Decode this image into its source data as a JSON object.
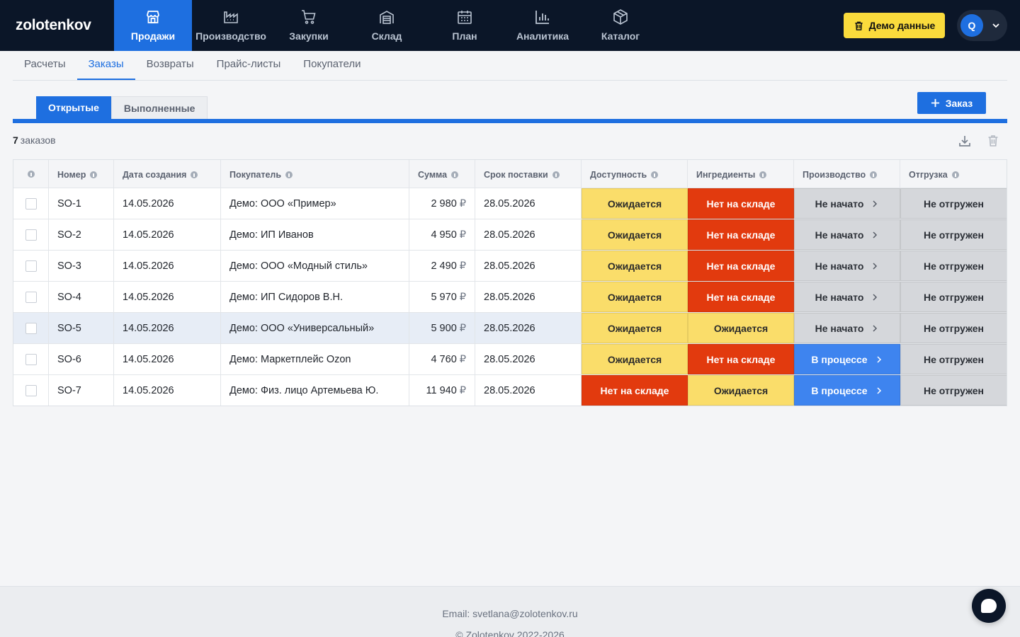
{
  "app": {
    "logo": "zolotenkov"
  },
  "topnav": [
    {
      "label": "Продажи",
      "icon": "store-icon",
      "active": true
    },
    {
      "label": "Производство",
      "icon": "factory-icon",
      "active": false
    },
    {
      "label": "Закупки",
      "icon": "cart-icon",
      "active": false
    },
    {
      "label": "Склад",
      "icon": "warehouse-icon",
      "active": false
    },
    {
      "label": "План",
      "icon": "calendar-icon",
      "active": false
    },
    {
      "label": "Аналитика",
      "icon": "bar-chart-icon",
      "active": false
    },
    {
      "label": "Каталог",
      "icon": "box-icon",
      "active": false
    }
  ],
  "header": {
    "demo_button": "Демо данные",
    "user_initial": "Q"
  },
  "subnav": [
    {
      "label": "Расчеты",
      "active": false
    },
    {
      "label": "Заказы",
      "active": true
    },
    {
      "label": "Возвраты",
      "active": false
    },
    {
      "label": "Прайс-листы",
      "active": false
    },
    {
      "label": "Покупатели",
      "active": false
    }
  ],
  "tabs": {
    "open": "Открытые",
    "done": "Выполненные"
  },
  "add_button": "Заказ",
  "summary": {
    "count": "7",
    "label": "заказов"
  },
  "table": {
    "columns": [
      "Номер",
      "Дата создания",
      "Покупатель",
      "Сумма",
      "Срок поставки",
      "Доступность",
      "Ингредиенты",
      "Производство",
      "Отгрузка"
    ],
    "currency": "₽",
    "rows": [
      {
        "number": "SO-1",
        "created": "14.05.2026",
        "customer": "Демо: ООО «Пример»",
        "sum": "2 980",
        "due": "28.05.2026",
        "availability": "Ожидается",
        "ingredients": "Нет на складе",
        "production": "Не начато",
        "shipment": "Не отгружен"
      },
      {
        "number": "SO-2",
        "created": "14.05.2026",
        "customer": "Демо: ИП Иванов",
        "sum": "4 950",
        "due": "28.05.2026",
        "availability": "Ожидается",
        "ingredients": "Нет на складе",
        "production": "Не начато",
        "shipment": "Не отгружен"
      },
      {
        "number": "SO-3",
        "created": "14.05.2026",
        "customer": "Демо: ООО «Модный стиль»",
        "sum": "2 490",
        "due": "28.05.2026",
        "availability": "Ожидается",
        "ingredients": "Нет на складе",
        "production": "Не начато",
        "shipment": "Не отгружен"
      },
      {
        "number": "SO-4",
        "created": "14.05.2026",
        "customer": "Демо: ИП Сидоров В.Н.",
        "sum": "5 970",
        "due": "28.05.2026",
        "availability": "Ожидается",
        "ingredients": "Нет на складе",
        "production": "Не начато",
        "shipment": "Не отгружен"
      },
      {
        "number": "SO-5",
        "created": "14.05.2026",
        "customer": "Демо: ООО «Универсальный»",
        "sum": "5 900",
        "due": "28.05.2026",
        "availability": "Ожидается",
        "ingredients": "Ожидается",
        "production": "Не начато",
        "shipment": "Не отгружен"
      },
      {
        "number": "SO-6",
        "created": "14.05.2026",
        "customer": "Демо: Маркетплейс Ozon",
        "sum": "4 760",
        "due": "28.05.2026",
        "availability": "Ожидается",
        "ingredients": "Нет на складе",
        "production": "В процессе",
        "shipment": "Не отгружен"
      },
      {
        "number": "SO-7",
        "created": "14.05.2026",
        "customer": "Демо: Физ. лицо Артемьева Ю.",
        "sum": "11 940",
        "due": "28.05.2026",
        "availability": "Нет на складе",
        "ingredients": "Ожидается",
        "production": "В процессе",
        "shipment": "Не отгружен"
      }
    ]
  },
  "footer": {
    "email": "Email: svetlana@zolotenkov.ru",
    "copyright": "© Zolotenkov 2022-2026"
  },
  "colors": {
    "accent": "#1e6fe0",
    "nav_bg": "#0b1628",
    "waiting": "#fadd6a",
    "out_of_stock": "#e23a0e",
    "not_started": "#d5d7db",
    "in_progress": "#3e84ef"
  }
}
